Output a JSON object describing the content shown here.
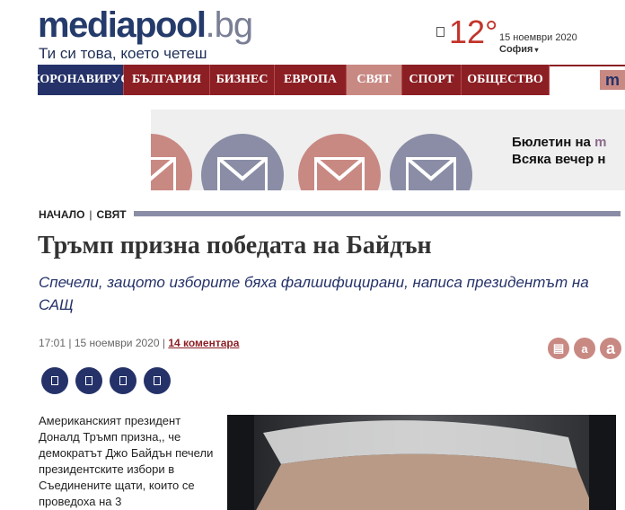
{
  "header": {
    "logo_main": "mediapool",
    "logo_tld": ".bg",
    "slogan": "Ти си това, което четеш",
    "weather": {
      "temperature": "12°",
      "date": "15 ноември 2020",
      "city": "София",
      "caret": "▾"
    }
  },
  "nav": {
    "items": [
      {
        "label": "КОРОНАВИРУС"
      },
      {
        "label": "БЪЛГАРИЯ"
      },
      {
        "label": "БИЗНЕС"
      },
      {
        "label": "ЕВРОПА"
      },
      {
        "label": "СВЯТ"
      },
      {
        "label": "СПОРТ"
      },
      {
        "label": "ОБЩЕСТВО"
      }
    ],
    "active_index": 4,
    "extra_label": "m"
  },
  "banner": {
    "line1_prefix": "Бюлетин на ",
    "line1_accent": "m",
    "line2": "Всяка вечер н"
  },
  "breadcrumb": {
    "home": "НАЧАЛО",
    "separator": "|",
    "section": "СВЯТ"
  },
  "article": {
    "title": "Тръмп призна победата на Байдън",
    "subtitle": "Спечели, защото изборите бяха фалшифицирани, написа президентът на САЩ",
    "time": "17:01",
    "date": "15 ноември 2020",
    "meta_separator": "|",
    "comments": "14 коментара",
    "lead": "Американският президент Доналд Тръмп призна,, че демократът Джо Байдън печели президентските избори в Съединените щати, които се проведоха на 3"
  },
  "tools": [
    {
      "icon": "print-icon",
      "glyph": "▤"
    },
    {
      "icon": "font-smaller-icon",
      "glyph": "a"
    },
    {
      "icon": "font-larger-icon",
      "glyph": "a"
    }
  ],
  "shares": [
    {
      "icon": "facebook-share-icon"
    },
    {
      "icon": "twitter-share-icon"
    },
    {
      "icon": "linkedin-share-icon"
    },
    {
      "icon": "email-share-icon"
    }
  ],
  "colors": {
    "navy": "#253269",
    "crimson": "#8c1f24",
    "rose": "#c98983",
    "slate": "#8a8da5"
  }
}
